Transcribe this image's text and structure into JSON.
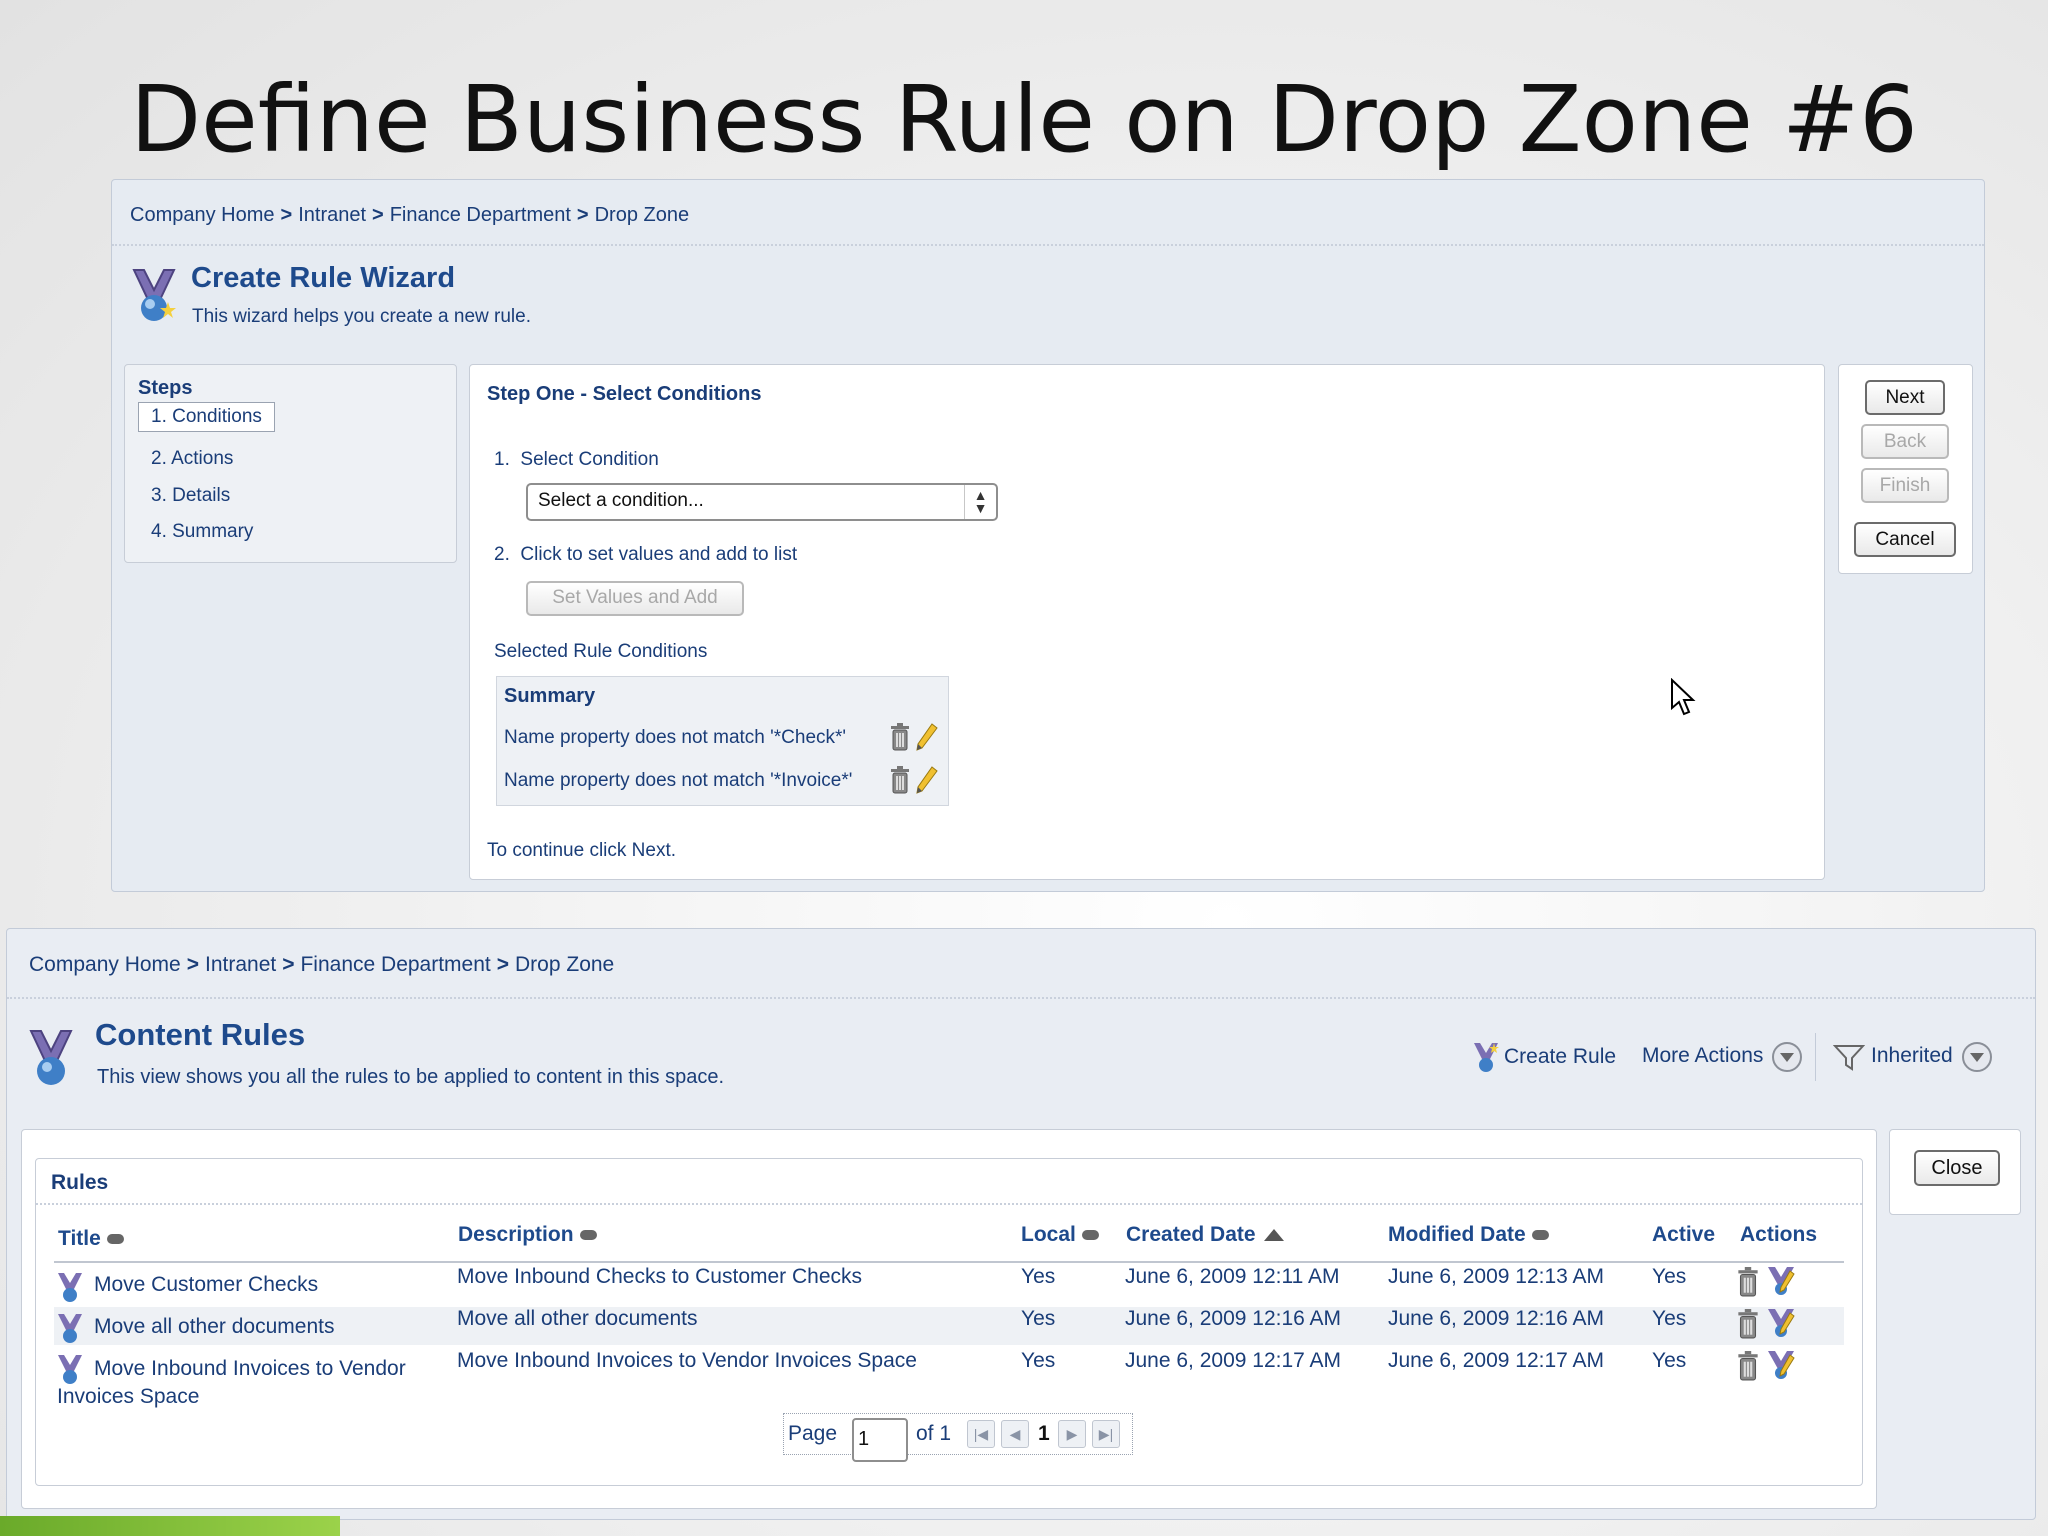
{
  "slide": {
    "title": "Define Business Rule on Drop Zone #6"
  },
  "wizard": {
    "breadcrumb": [
      "Company Home",
      "Intranet",
      "Finance Department",
      "Drop Zone"
    ],
    "breadcrumb_sep": ">",
    "title": "Create Rule Wizard",
    "subtitle": "This wizard helps you create a new rule.",
    "steps_heading": "Steps",
    "steps": [
      "1. Conditions",
      "2. Actions",
      "3. Details",
      "4. Summary"
    ],
    "step_heading": "Step One - Select Conditions",
    "select_condition_label": "1.  Select Condition",
    "select_value": "Select a condition...",
    "click_to_set_label": "2.  Click to set values and add to list",
    "set_values_button": "Set Values and Add",
    "selected_conditions_label": "Selected Rule Conditions",
    "summary_header": "Summary",
    "conditions": [
      "Name property does not match '*Check*'",
      "Name property does not match '*Invoice*'"
    ],
    "continue_text": "To continue click Next.",
    "buttons": {
      "next": "Next",
      "back": "Back",
      "finish": "Finish",
      "cancel": "Cancel"
    }
  },
  "content_rules": {
    "breadcrumb": [
      "Company Home",
      "Intranet",
      "Finance Department",
      "Drop Zone"
    ],
    "breadcrumb_sep": ">",
    "title": "Content Rules",
    "subtitle": "This view shows you all the rules to be applied to content in this space.",
    "toolbar": {
      "create_rule": "Create Rule",
      "more_actions": "More Actions",
      "inherited": "Inherited"
    },
    "close_button": "Close",
    "rules_heading": "Rules",
    "columns": [
      "Title",
      "Description",
      "Local",
      "Created Date",
      "Modified Date",
      "Active",
      "Actions"
    ],
    "rows": [
      {
        "title": "Move Customer Checks",
        "description": "Move Inbound Checks to Customer Checks",
        "local": "Yes",
        "created": "June 6, 2009 12:11 AM",
        "modified": "June 6, 2009 12:13 AM",
        "active": "Yes"
      },
      {
        "title": "Move all other documents",
        "description": "Move all other documents",
        "local": "Yes",
        "created": "June 6, 2009 12:16 AM",
        "modified": "June 6, 2009 12:16 AM",
        "active": "Yes"
      },
      {
        "title_line1": "Move Inbound Invoices to Vendor",
        "title_line2": "Invoices Space",
        "description": "Move Inbound Invoices to Vendor Invoices Space",
        "local": "Yes",
        "created": "June 6, 2009 12:17 AM",
        "modified": "June 6, 2009 12:17 AM",
        "active": "Yes"
      }
    ],
    "pager": {
      "page_label": "Page",
      "page_value": "1",
      "of_label": "of 1",
      "current": "1"
    }
  },
  "colors": {
    "link": "#1a3d78",
    "panel": "#e6ebf2",
    "accent_green": "#6aaa2a"
  }
}
